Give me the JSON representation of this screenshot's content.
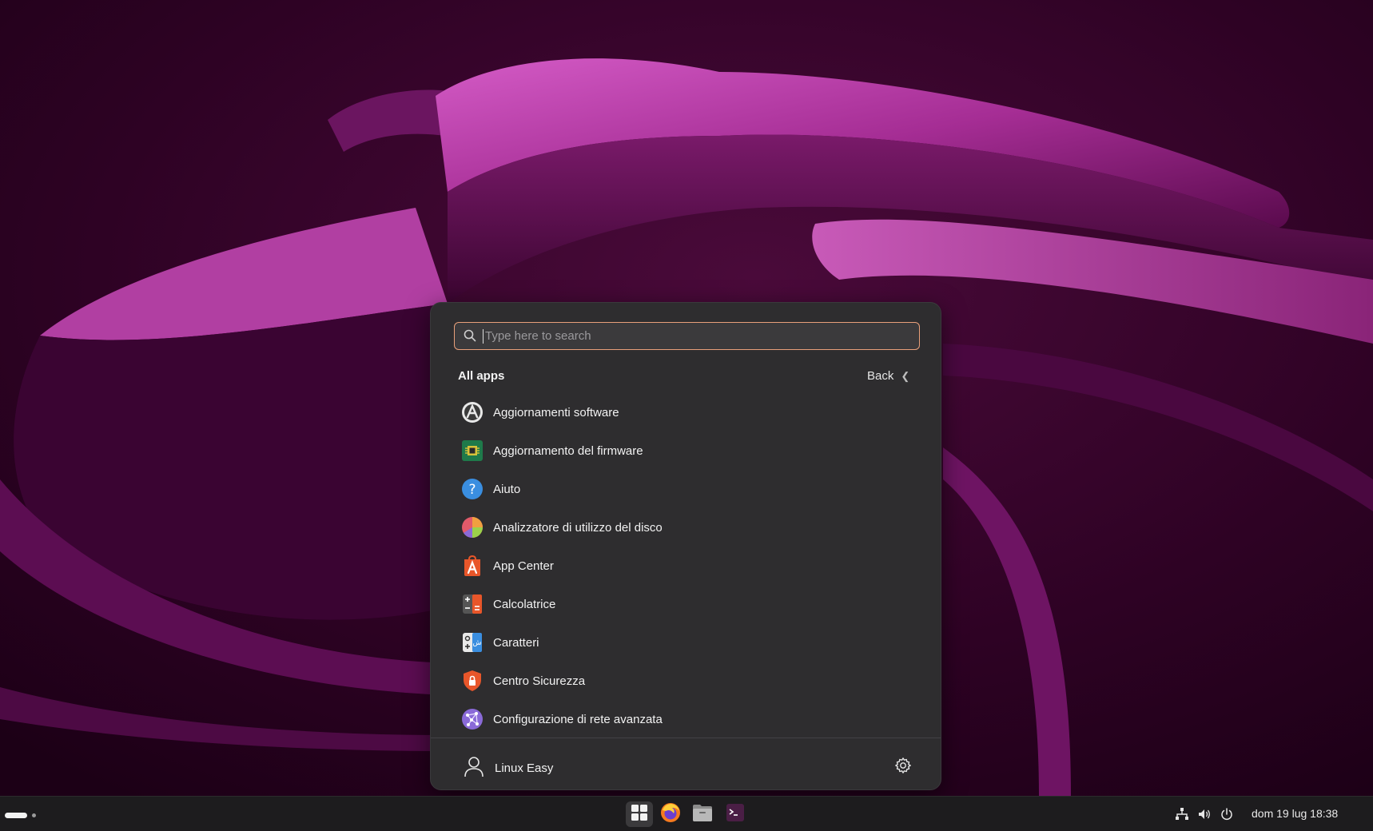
{
  "search": {
    "placeholder": "Type here to search"
  },
  "section": {
    "title": "All apps",
    "back_label": "Back"
  },
  "apps": [
    {
      "label": "Aggiornamenti software",
      "icon": "software-updater-icon"
    },
    {
      "label": "Aggiornamento del firmware",
      "icon": "firmware-chip-icon"
    },
    {
      "label": "Aiuto",
      "icon": "help-question-icon"
    },
    {
      "label": "Analizzatore di utilizzo del disco",
      "icon": "disk-usage-pie-icon"
    },
    {
      "label": "App Center",
      "icon": "app-center-icon"
    },
    {
      "label": "Calcolatrice",
      "icon": "calculator-icon"
    },
    {
      "label": "Caratteri",
      "icon": "characters-icon"
    },
    {
      "label": "Centro Sicurezza",
      "icon": "security-shield-icon"
    },
    {
      "label": "Configurazione di rete avanzata",
      "icon": "network-config-icon"
    }
  ],
  "user": {
    "name": "Linux Easy"
  },
  "taskbar": {
    "clock": "dom 19 lug  18:38",
    "apps": [
      "apps-grid-icon",
      "firefox-icon",
      "files-icon",
      "terminal-icon"
    ]
  },
  "colors": {
    "accent": "#e9a07a",
    "menu_bg": "#2e2d2f",
    "taskbar_bg": "#1d1c1e"
  }
}
